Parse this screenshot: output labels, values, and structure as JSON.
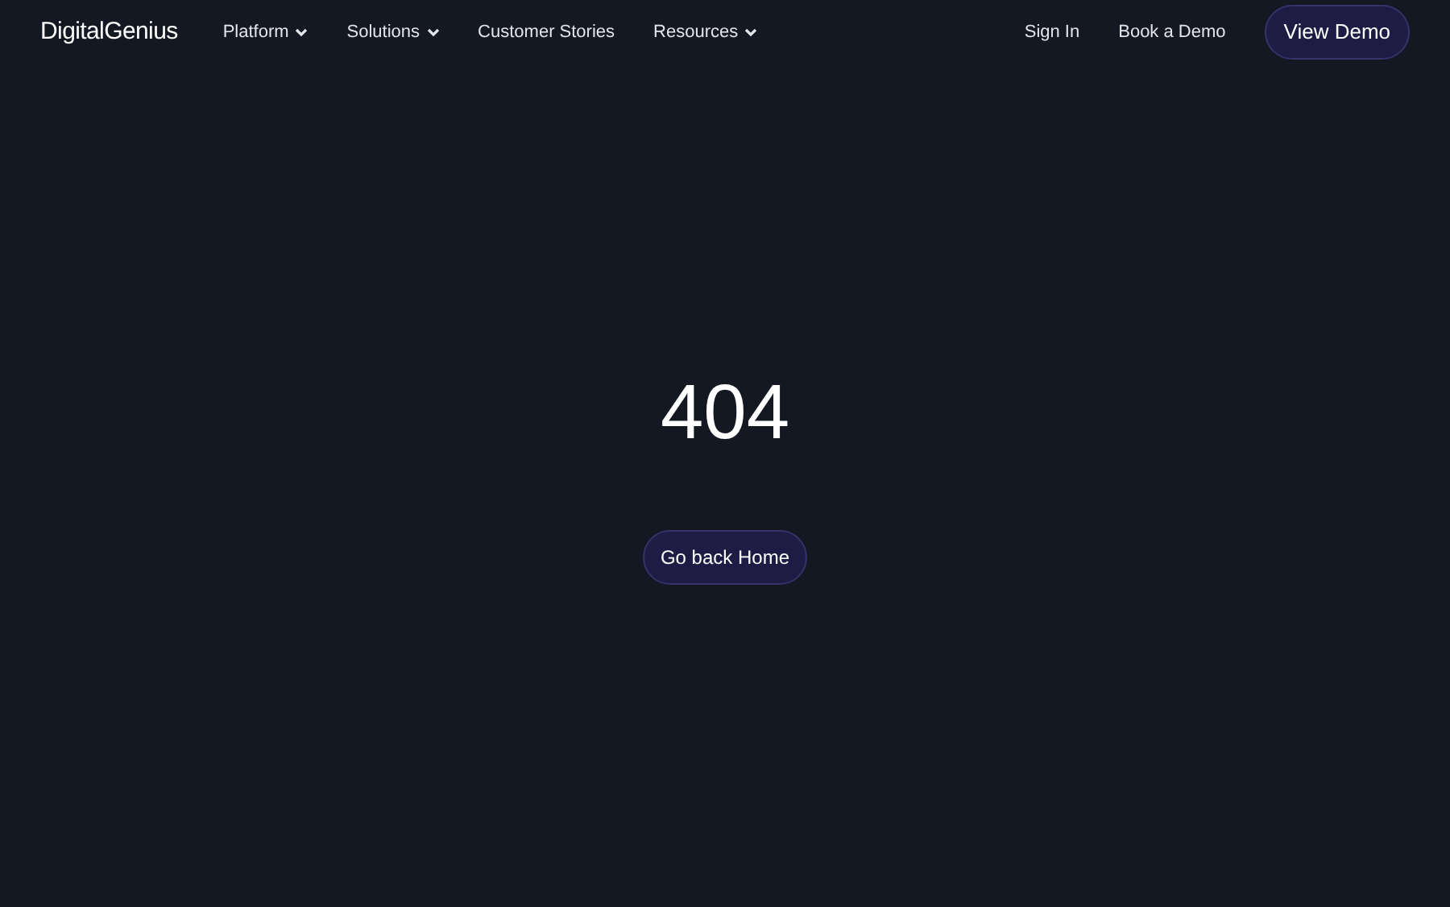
{
  "logo": "DigitalGenius",
  "nav": [
    {
      "label": "Platform",
      "dropdown": true
    },
    {
      "label": "Solutions",
      "dropdown": true
    },
    {
      "label": "Customer Stories",
      "dropdown": false
    },
    {
      "label": "Resources",
      "dropdown": true
    }
  ],
  "actions": [
    {
      "label": "Sign In",
      "kind": "link"
    },
    {
      "label": "Book a Demo",
      "kind": "link"
    },
    {
      "label": "View Demo",
      "kind": "button"
    }
  ],
  "error": {
    "code": "404",
    "button": "Go back Home"
  }
}
